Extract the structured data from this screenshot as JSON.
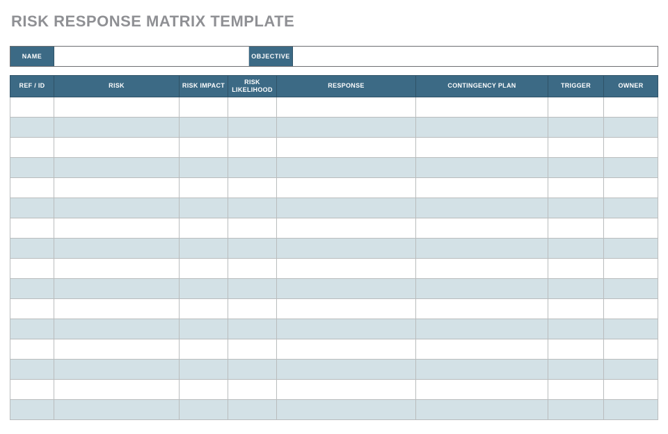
{
  "title": "RISK RESPONSE MATRIX TEMPLATE",
  "meta": {
    "name_label": "NAME",
    "name_value": "",
    "objective_label": "OBJECTIVE",
    "objective_value": ""
  },
  "columns": [
    "REF / ID",
    "RISK",
    "RISK IMPACT",
    "RISK LIKELIHOOD",
    "RESPONSE",
    "CONTINGENCY PLAN",
    "TRIGGER",
    "OWNER"
  ],
  "rows": [
    {
      "ref": "",
      "risk": "",
      "impact": "",
      "likelihood": "",
      "response": "",
      "contingency": "",
      "trigger": "",
      "owner": ""
    },
    {
      "ref": "",
      "risk": "",
      "impact": "",
      "likelihood": "",
      "response": "",
      "contingency": "",
      "trigger": "",
      "owner": ""
    },
    {
      "ref": "",
      "risk": "",
      "impact": "",
      "likelihood": "",
      "response": "",
      "contingency": "",
      "trigger": "",
      "owner": ""
    },
    {
      "ref": "",
      "risk": "",
      "impact": "",
      "likelihood": "",
      "response": "",
      "contingency": "",
      "trigger": "",
      "owner": ""
    },
    {
      "ref": "",
      "risk": "",
      "impact": "",
      "likelihood": "",
      "response": "",
      "contingency": "",
      "trigger": "",
      "owner": ""
    },
    {
      "ref": "",
      "risk": "",
      "impact": "",
      "likelihood": "",
      "response": "",
      "contingency": "",
      "trigger": "",
      "owner": ""
    },
    {
      "ref": "",
      "risk": "",
      "impact": "",
      "likelihood": "",
      "response": "",
      "contingency": "",
      "trigger": "",
      "owner": ""
    },
    {
      "ref": "",
      "risk": "",
      "impact": "",
      "likelihood": "",
      "response": "",
      "contingency": "",
      "trigger": "",
      "owner": ""
    },
    {
      "ref": "",
      "risk": "",
      "impact": "",
      "likelihood": "",
      "response": "",
      "contingency": "",
      "trigger": "",
      "owner": ""
    },
    {
      "ref": "",
      "risk": "",
      "impact": "",
      "likelihood": "",
      "response": "",
      "contingency": "",
      "trigger": "",
      "owner": ""
    },
    {
      "ref": "",
      "risk": "",
      "impact": "",
      "likelihood": "",
      "response": "",
      "contingency": "",
      "trigger": "",
      "owner": ""
    },
    {
      "ref": "",
      "risk": "",
      "impact": "",
      "likelihood": "",
      "response": "",
      "contingency": "",
      "trigger": "",
      "owner": ""
    },
    {
      "ref": "",
      "risk": "",
      "impact": "",
      "likelihood": "",
      "response": "",
      "contingency": "",
      "trigger": "",
      "owner": ""
    },
    {
      "ref": "",
      "risk": "",
      "impact": "",
      "likelihood": "",
      "response": "",
      "contingency": "",
      "trigger": "",
      "owner": ""
    },
    {
      "ref": "",
      "risk": "",
      "impact": "",
      "likelihood": "",
      "response": "",
      "contingency": "",
      "trigger": "",
      "owner": ""
    },
    {
      "ref": "",
      "risk": "",
      "impact": "",
      "likelihood": "",
      "response": "",
      "contingency": "",
      "trigger": "",
      "owner": ""
    }
  ]
}
